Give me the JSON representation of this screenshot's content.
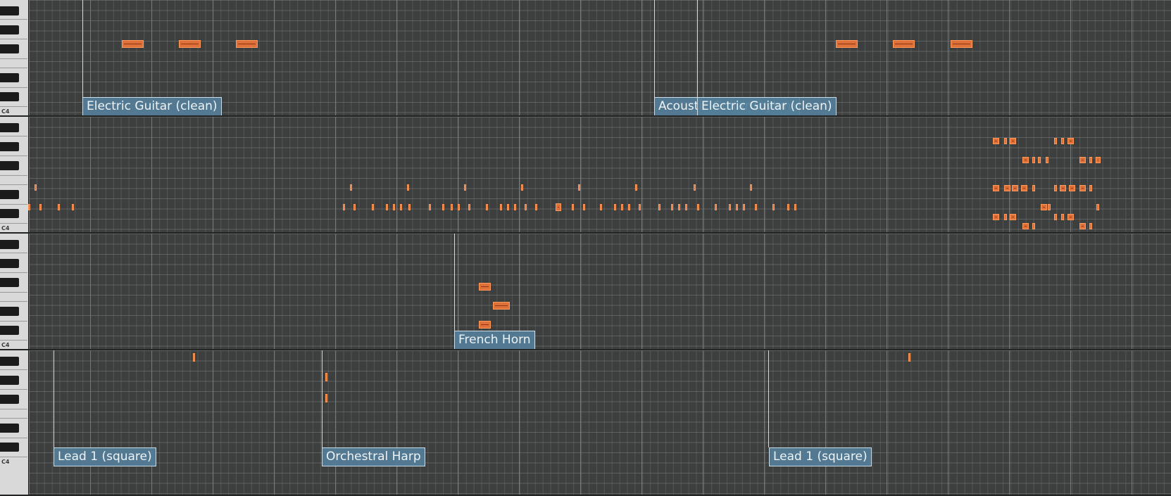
{
  "app": {
    "view": "Piano Roll"
  },
  "keyboard": {
    "octave_label": "C4"
  },
  "colors": {
    "note": "#e0703a",
    "label_bg": "#547e98",
    "grid": "#3d3e3e",
    "marker": "#d8d8d8"
  },
  "lanes": [
    {
      "track_labels": [
        "Electric Guitar (clean)",
        "Acoustic Guitar (nylon)",
        "Electric Guitar (clean)"
      ]
    },
    {
      "track_labels": []
    },
    {
      "track_labels": [
        "French Horn"
      ]
    },
    {
      "track_labels": [
        "Lead 1 (square)",
        "Orchestral Harp",
        "Lead 1 (square)"
      ]
    }
  ]
}
